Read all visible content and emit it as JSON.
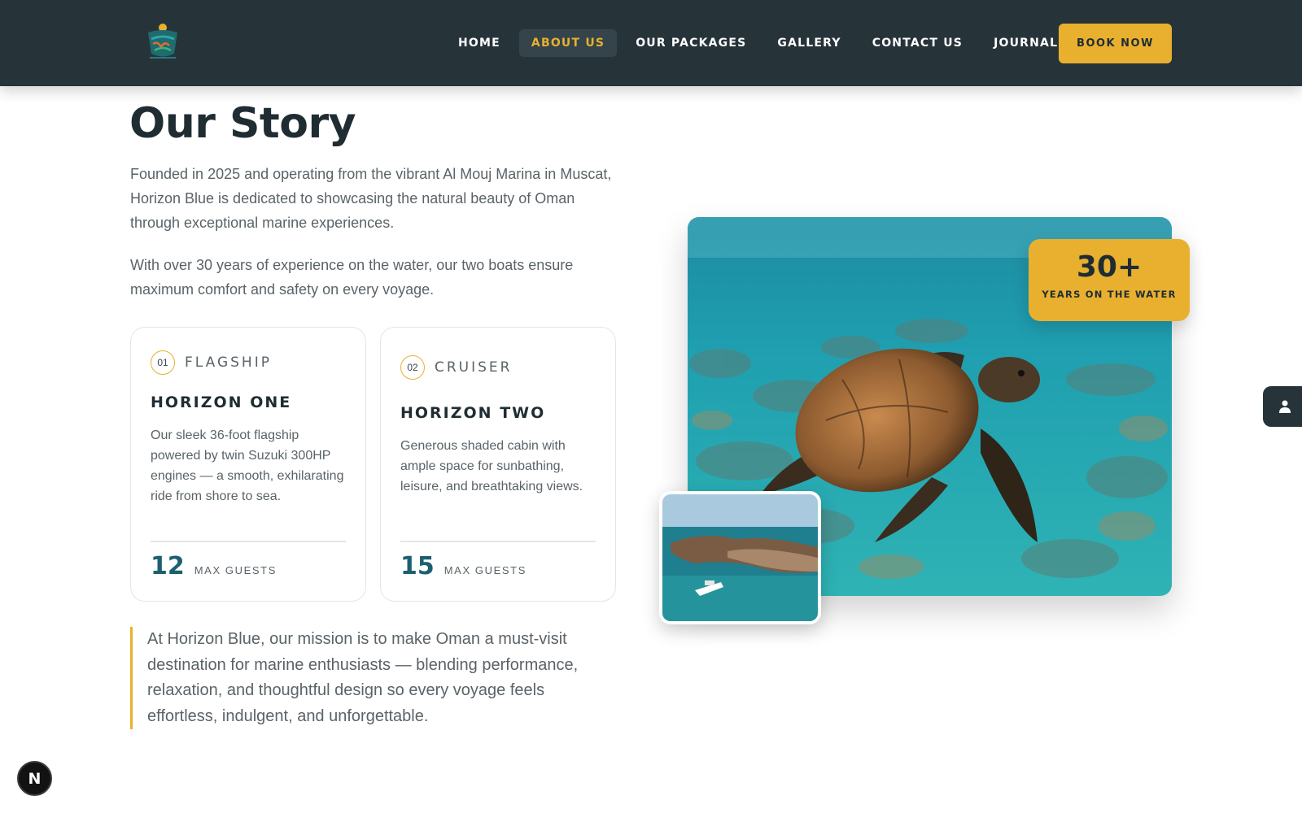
{
  "header": {
    "nav": [
      "HOME",
      "ABOUT US",
      "OUR PACKAGES",
      "GALLERY",
      "CONTACT US",
      "JOURNAL"
    ],
    "active_nav": "ABOUT US",
    "book_label": "BOOK NOW"
  },
  "story": {
    "title": "Our Story",
    "paragraph_1": "Founded in 2025 and operating from the vibrant Al Mouj Marina in Muscat, Horizon Blue is dedicated to showcasing the natural beauty of Oman through exceptional marine experiences.",
    "paragraph_2": "With over 30 years of experience on the water, our two boats ensure maximum comfort and safety on every voyage."
  },
  "boats": [
    {
      "number": "01",
      "tag": "FLAGSHIP",
      "name": "HORIZON ONE",
      "description": "Our sleek 36-foot flagship powered by twin Suzuki 300HP engines — a smooth, exhilarating ride from shore to sea.",
      "guests": "12",
      "guests_label": "MAX GUESTS"
    },
    {
      "number": "02",
      "tag": "CRUISER",
      "name": "HORIZON TWO",
      "description": "Generous shaded cabin with ample space for sunbathing, leisure, and breathtaking views.",
      "guests": "15",
      "guests_label": "MAX GUESTS"
    }
  ],
  "mission": "At Horizon Blue, our mission is to make Oman a must-visit destination for marine enthusiasts — blending performance, relaxation, and thoughtful design so every voyage feels effortless, indulgent, and unforgettable.",
  "stat": {
    "value": "30+",
    "label": "YEARS ON THE WATER"
  },
  "floating": {
    "n_button": "N"
  },
  "colors": {
    "header_bg": "#26343a",
    "accent": "#e9b02f",
    "stat_number": "#1c6070"
  }
}
